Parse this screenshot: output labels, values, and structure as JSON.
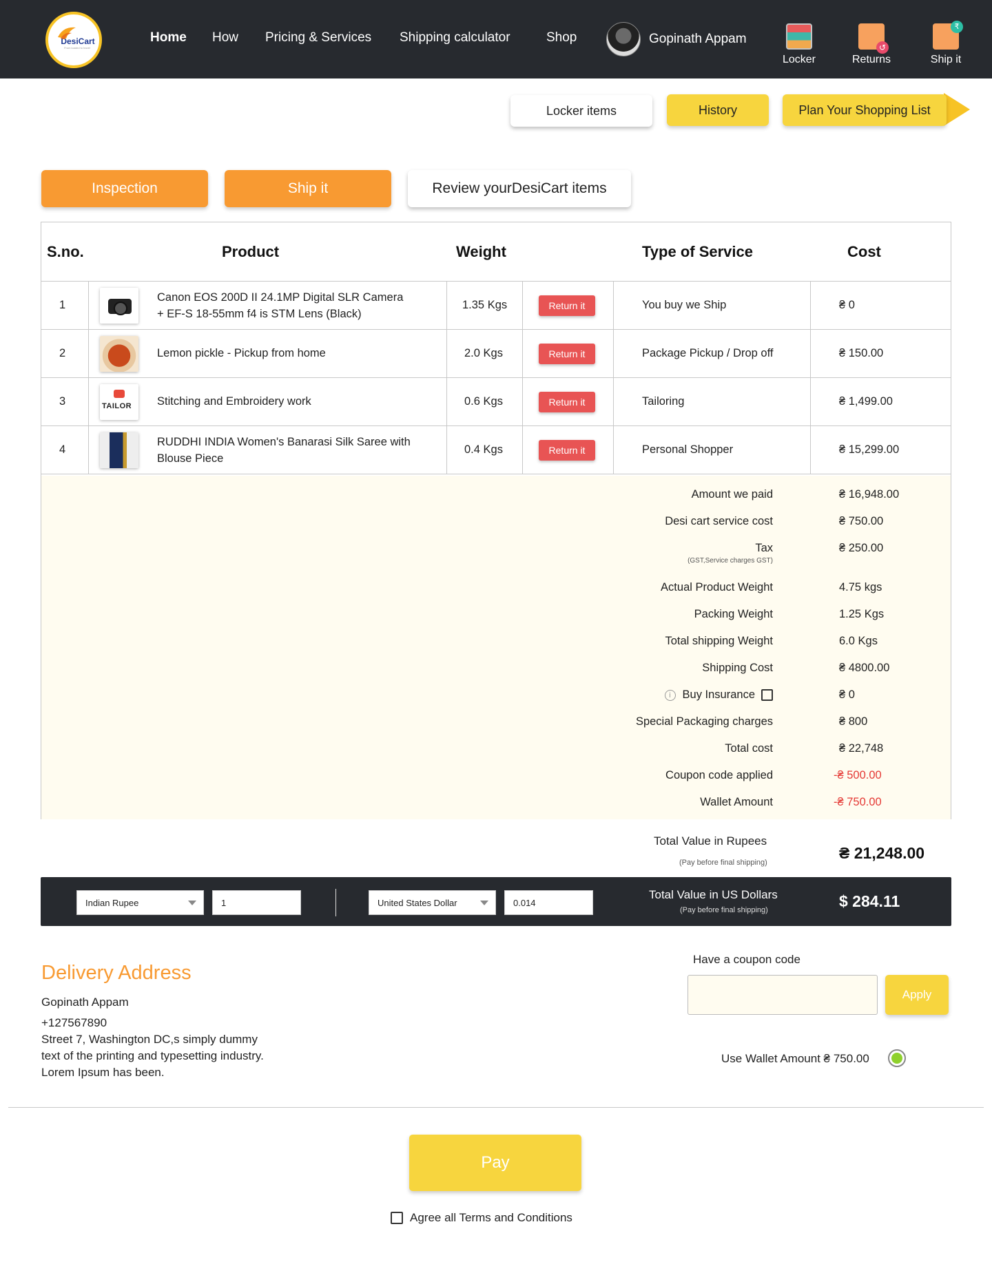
{
  "brand": {
    "name": "DesiCart",
    "tagline": "From loaded to travel"
  },
  "nav": {
    "items": [
      {
        "label": "Home",
        "active": true
      },
      {
        "label": "How",
        "active": false
      },
      {
        "label": "Pricing & Services",
        "active": false
      },
      {
        "label": "Shipping calculator",
        "active": false
      },
      {
        "label": "Shop",
        "active": false
      }
    ]
  },
  "user": {
    "name": "Gopinath Appam"
  },
  "header_icons": [
    {
      "label": "Locker",
      "icon": "locker-icon"
    },
    {
      "label": "Returns",
      "icon": "returns-icon"
    },
    {
      "label": "Ship it",
      "icon": "ship-it-icon"
    }
  ],
  "top_actions": {
    "locker_items": "Locker items",
    "history": "History",
    "plan": "Plan Your Shopping List"
  },
  "tabs": {
    "inspection": "Inspection",
    "ship_it": "Ship it",
    "review": "Review yourDesiCart items"
  },
  "table": {
    "headers": {
      "sno": "S.no.",
      "product": "Product",
      "weight": "Weight",
      "service": "Type of Service",
      "cost": "Cost"
    },
    "return_label": "Return it",
    "rows": [
      {
        "sno": "1",
        "product_line1": "Canon EOS 200D II 24.1MP Digital SLR Camera",
        "product_line2": "+ EF-S 18-55mm f4 is STM Lens (Black)",
        "weight": "1.35 Kgs",
        "service": "You buy we Ship",
        "cost": "₴ 0",
        "thumb": "camera"
      },
      {
        "sno": "2",
        "product_line1": "Lemon pickle - Pickup from home",
        "product_line2": "",
        "weight": "2.0 Kgs",
        "service": "Package Pickup / Drop off",
        "cost": "₴ 150.00",
        "thumb": "pickle"
      },
      {
        "sno": "3",
        "product_line1": "Stitching and Embroidery work",
        "product_line2": "",
        "weight": "0.6 Kgs",
        "service": "Tailoring",
        "cost": "₴ 1,499.00",
        "thumb": "tailor"
      },
      {
        "sno": "4",
        "product_line1": "RUDDHI INDIA Women's Banarasi Silk Saree with",
        "product_line2": "Blouse Piece",
        "weight": "0.4 Kgs",
        "service": "Personal Shopper",
        "cost": "₴ 15,299.00",
        "thumb": "saree"
      }
    ],
    "tailor_thumb_text": "TAILOR"
  },
  "summary": {
    "amount_paid": {
      "label": "Amount we paid",
      "value": "₴ 16,948.00"
    },
    "service_cost": {
      "label": "Desi cart service cost",
      "value": "₴ 750.00"
    },
    "tax": {
      "label": "Tax",
      "note": "(GST,Service charges GST)",
      "value": "₴ 250.00"
    },
    "actual_weight": {
      "label": "Actual Product Weight",
      "value": "4.75 kgs"
    },
    "packing_weight": {
      "label": "Packing Weight",
      "value": "1.25 Kgs"
    },
    "total_weight": {
      "label": "Total shipping Weight",
      "value": "6.0 Kgs"
    },
    "shipping_cost": {
      "label": "Shipping Cost",
      "value": "₴ 4800.00"
    },
    "insurance": {
      "label": "Buy Insurance",
      "value": "₴ 0",
      "checked": false
    },
    "special_packaging": {
      "label": "Special Packaging charges",
      "value": "₴ 800"
    },
    "total_cost": {
      "label": "Total cost",
      "value": "₴ 22,748"
    },
    "coupon": {
      "label": "Coupon code applied",
      "value": "-₴ 500.00"
    },
    "wallet": {
      "label": "Wallet Amount",
      "value": "-₴ 750.00"
    }
  },
  "totals": {
    "rupees_label": "Total Value in Rupees",
    "rupees_note": "(Pay before final shipping)",
    "rupees_value": "₴ 21,248.00",
    "usd_label": "Total Value in US Dollars",
    "usd_note": "(Pay before final shipping)",
    "usd_value": "$ 284.11"
  },
  "converter": {
    "from_currency": "Indian Rupee",
    "from_amount": "1",
    "to_currency": "United States Dollar",
    "to_amount": "0.014"
  },
  "delivery": {
    "title": "Delivery Address",
    "name": "Gopinath Appam",
    "phone": "+127567890",
    "address_line1": "Street 7, Washington DC,s simply dummy",
    "address_line2": "text of the printing and typesetting industry.",
    "address_line3": "Lorem Ipsum has been."
  },
  "coupon": {
    "label": "Have a coupon code",
    "placeholder": "",
    "apply": "Apply"
  },
  "wallet": {
    "label": "Use Wallet Amount ₴ 750.00",
    "selected": true
  },
  "pay": {
    "label": "Pay"
  },
  "terms": {
    "label": "Agree all Terms and Conditions",
    "checked": false
  },
  "colors": {
    "dark": "#272a2f",
    "orange": "#f89a32",
    "yellow": "#f7d53e",
    "red": "#e85454",
    "cream": "#fffcf0"
  }
}
